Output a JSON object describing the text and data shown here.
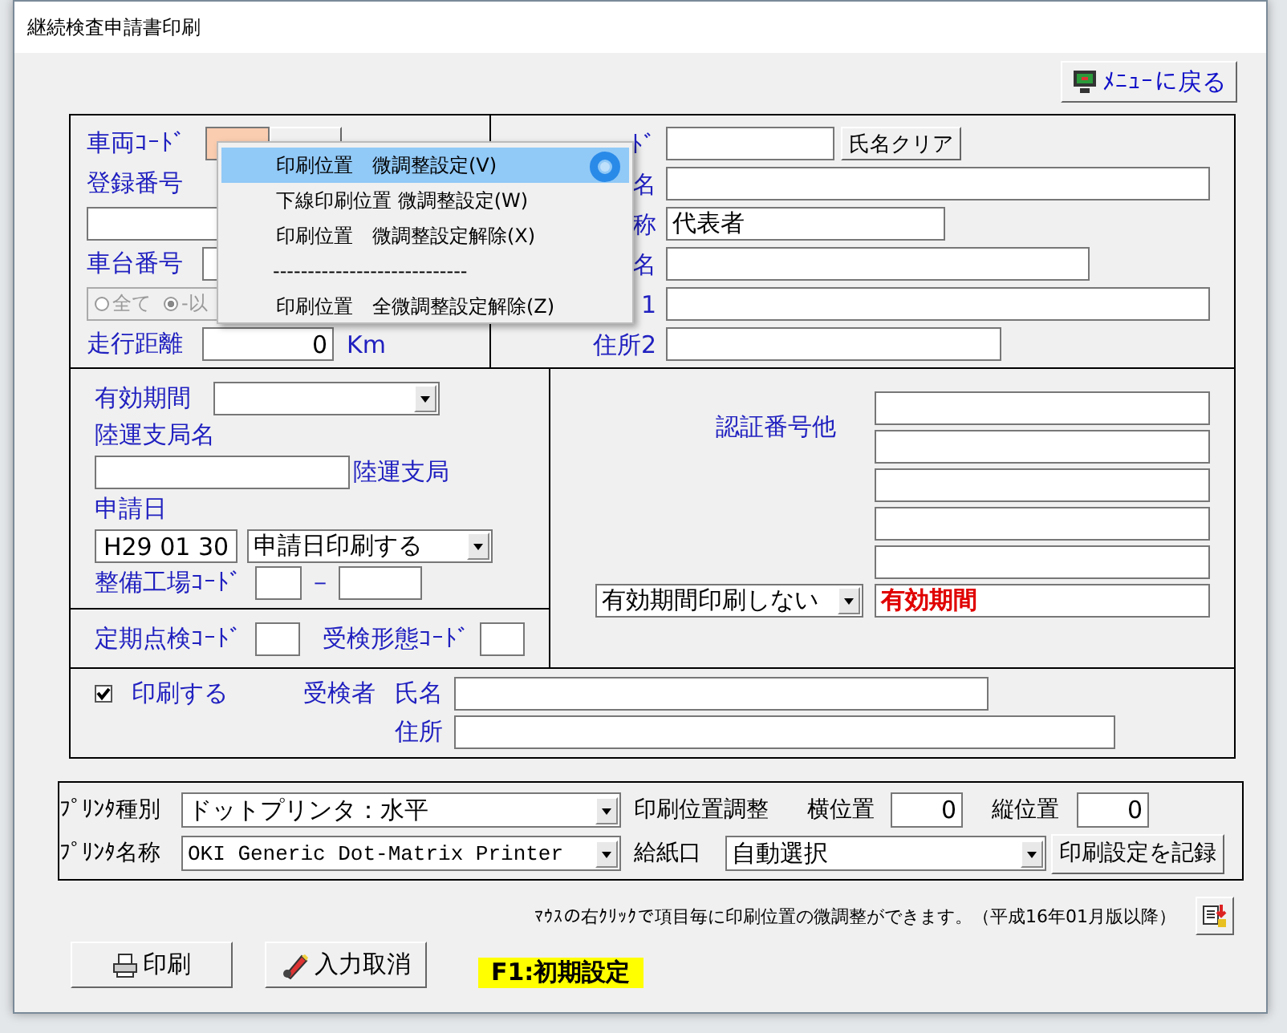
{
  "window": {
    "title": "継続検査申請書印刷"
  },
  "menu_button": {
    "label": "ﾒﾆｭｰに戻る"
  },
  "vehicle": {
    "code_label": "車両ｺｰﾄﾞ",
    "reg_label": "登録番号",
    "chassis_label": "車台番号",
    "radios": [
      {
        "label": "全て",
        "selected": false
      },
      {
        "label": "-以",
        "selected": true
      }
    ],
    "mileage_label": "走行距離",
    "mileage": "0",
    "mileage_unit": "Km"
  },
  "user": {
    "code_label": "ﾄﾞ",
    "name_clear_button": "氏名クリア",
    "fields": [
      {
        "label": "名"
      },
      {
        "label": "称",
        "value": "代表者"
      },
      {
        "label": "名"
      },
      {
        "label": "1"
      },
      {
        "label": "住所2"
      }
    ]
  },
  "validity": {
    "label": "有効期間",
    "office_label": "陸運支局名",
    "office_suffix": "陸運支局",
    "date_label": "申請日",
    "date": "H29 01 30",
    "date_print": "申請日印刷する",
    "factory_label": "整備工場ｺｰﾄﾞ",
    "dash": "－"
  },
  "inspection": {
    "periodic_label": "定期点検ｺｰﾄﾞ",
    "type_label": "受検形態ｺｰﾄﾞ"
  },
  "certification": {
    "label": "認証番号他",
    "validity_print": "有効期間印刷しない",
    "validity_text": "有効期間"
  },
  "examinee": {
    "print_label": "印刷する",
    "print_checked": true,
    "label": "受検者",
    "name_label": "氏名",
    "address_label": "住所"
  },
  "printer": {
    "type_label": "ﾌﾟﾘﾝﾀ種別",
    "type": "ドットプリンタ：水平",
    "name_label": "ﾌﾟﾘﾝﾀ名称",
    "name": "OKI Generic Dot-Matrix Printer",
    "adjust_label": "印刷位置調整",
    "h_label": "横位置",
    "h": "0",
    "v_label": "縦位置",
    "v": "0",
    "tray_label": "給紙口",
    "tray": "自動選択",
    "save_button": "印刷設定を記録"
  },
  "note": "ﾏｳｽの右ｸﾘｯｸで項目毎に印刷位置の微調整ができます。（平成16年01月版以降）",
  "buttons": [
    {
      "label": "印刷",
      "kind": "print"
    },
    {
      "label": "入力取消",
      "kind": "cancel"
    }
  ],
  "hint": "F1:初期設定",
  "context_menu": [
    {
      "kind": "item",
      "label": "印刷位置　微調整設定(V)",
      "selected": true
    },
    {
      "kind": "item",
      "label": "下線印刷位置 微調整設定(W)",
      "selected": false
    },
    {
      "kind": "item",
      "label": "印刷位置　微調整設定解除(X)",
      "selected": false
    },
    {
      "kind": "separator",
      "label": "----------------------------"
    },
    {
      "kind": "item",
      "label": "印刷位置　全微調整設定解除(Z)",
      "selected": false
    }
  ]
}
